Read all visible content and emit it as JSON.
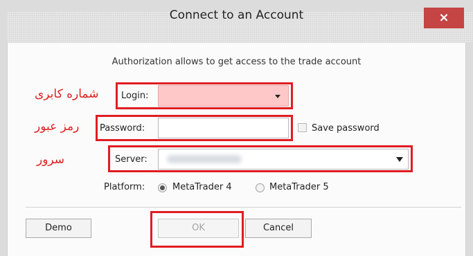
{
  "dialog": {
    "title": "Connect to an Account",
    "close_glyph": "×",
    "description": "Authorization allows to get access to the trade account"
  },
  "annotations": {
    "login": "شماره کابری",
    "password": "رمز عبور",
    "server": "سرور"
  },
  "form": {
    "login_label": "Login:",
    "login_value": "",
    "password_label": "Password:",
    "password_value": "",
    "save_password_label": "Save password",
    "save_password_checked": false,
    "server_label": "Server:",
    "server_value": "",
    "platform_label": "Platform:",
    "platform_options": [
      "MetaTrader 4",
      "MetaTrader 5"
    ],
    "platform_selected": "MetaTrader 4"
  },
  "buttons": {
    "demo": "Demo",
    "ok": "OK",
    "cancel": "Cancel"
  },
  "colors": {
    "highlight": "#e01c22",
    "login_fill": "#ffc8c8",
    "close": "#c54444"
  }
}
